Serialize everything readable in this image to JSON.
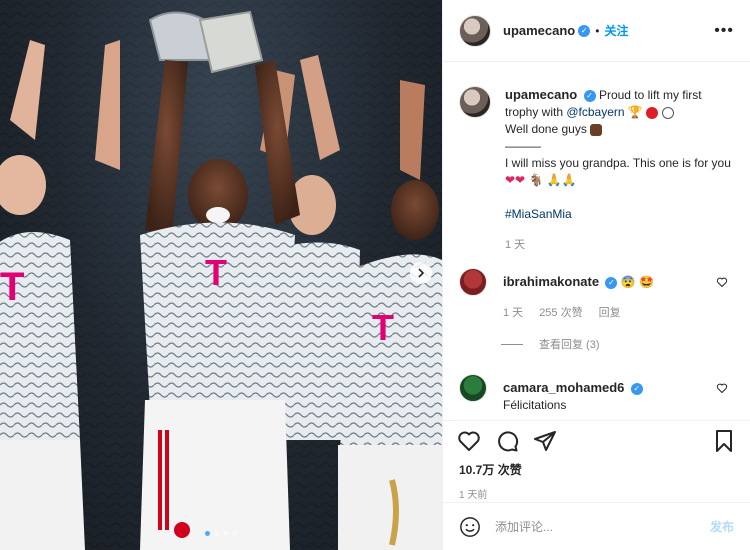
{
  "photo": {
    "description_icon": "photo-carousel",
    "carousel_dot_count": 4,
    "active_dot_index": 0,
    "jersey_text": "T"
  },
  "header": {
    "username": "upamecano",
    "separator": "•",
    "follow_label": "关注",
    "more_icon": "more-icon"
  },
  "caption": {
    "username": "upamecano",
    "text_before_mention": "Proud to lift my first trophy with ",
    "mention": "@fcbayern",
    "line2": "Well done guys",
    "divider": "———",
    "line3": "I will miss you grandpa. This one is for you",
    "hashtag": "#MiaSanMia",
    "time": "1 天"
  },
  "comments": [
    {
      "username": "ibrahimakonate",
      "time": "1 天",
      "likes": "255 次赞",
      "reply_label": "回复",
      "view_replies": "查看回复 (3)"
    },
    {
      "username": "camara_mohamed6",
      "text": "Félicitations"
    }
  ],
  "actions": {
    "likes": "10.7万 次赞",
    "time_ago": "1 天前"
  },
  "add_comment": {
    "placeholder": "添加评论...",
    "post_label": "发布"
  },
  "colors": {
    "link": "#00376b",
    "accent": "#0095f6",
    "verified": "#3897f0",
    "muted": "#8e8e8e"
  }
}
